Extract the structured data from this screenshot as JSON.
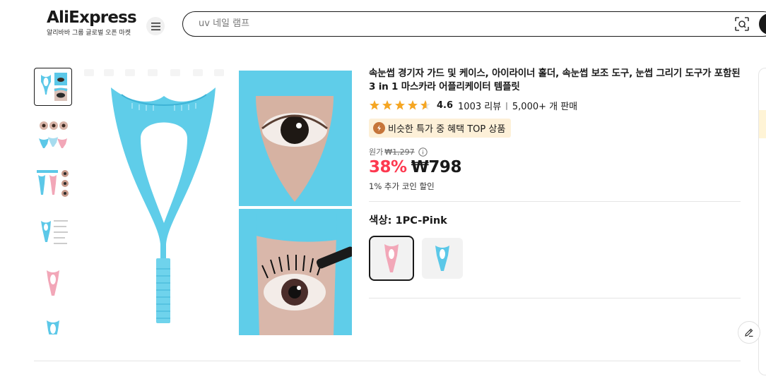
{
  "header": {
    "logo_text": "AliExpress",
    "logo_subtitle": "알리바바 그룹 글로벌 오픈 마켓",
    "menu_icon": "hamburger-icon",
    "search_placeholder": "uv 네일 램프",
    "camera_icon": "camera-search-icon"
  },
  "gallery": {
    "thumbnail_count": 6,
    "selected_index": 0
  },
  "product": {
    "title": "속눈썹 경기자 가드 및 케이스, 아이라이너 홀더, 속눈썹 보조 도구, 눈썹 그리기 도구가 포함된 3 in 1 마스카라 어플리케이터 템플릿",
    "rating": {
      "stars": 4.6,
      "score": "4.6",
      "reviews": "1003 리뷰",
      "separator": "|",
      "sold": "5,000+ 개 판매"
    },
    "badge": "비슷한 특가 중 혜택 TOP 상품",
    "original_label": "원가",
    "original_price": "₩1,297",
    "discount": "38%",
    "price": "₩798",
    "coin_discount": "1% 추가 코인 할인",
    "color_label": "색상: 1PC-Pink",
    "color_options": [
      {
        "name": "1PC-Pink",
        "selected": true
      },
      {
        "name": "1PC-Blue",
        "selected": false
      }
    ]
  },
  "colors": {
    "accent_red": "#fd384f",
    "badge_bg": "#fdf0d8",
    "star": "#f5a623",
    "product_blue": "#5cc8e8",
    "product_pink": "#f2a7b8"
  }
}
